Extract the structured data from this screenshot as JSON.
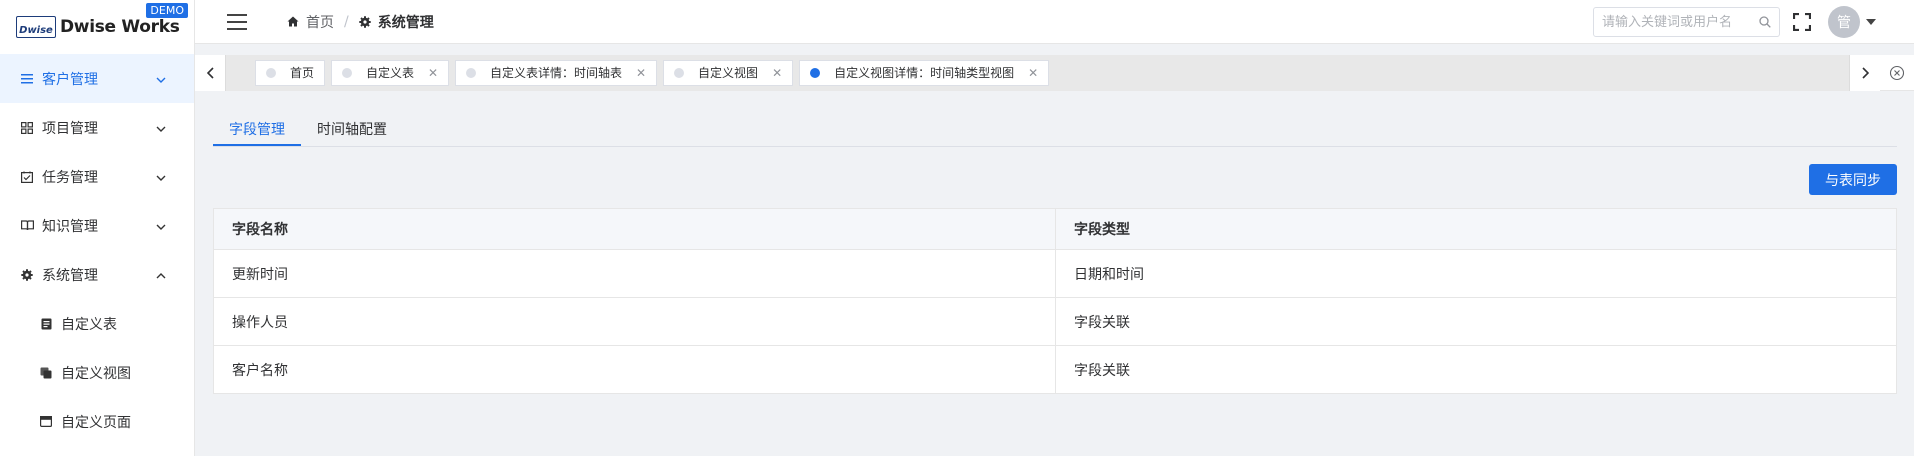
{
  "app": {
    "logo_mark": "Dwise",
    "title": "Dwise Works",
    "badge": "DEMO"
  },
  "sidebar": {
    "items": [
      {
        "label": "客户管理",
        "icon": "list-icon",
        "active": true,
        "expanded": false
      },
      {
        "label": "项目管理",
        "icon": "grid-icon",
        "active": false,
        "expanded": false
      },
      {
        "label": "任务管理",
        "icon": "check-square-icon",
        "active": false,
        "expanded": false
      },
      {
        "label": "知识管理",
        "icon": "book-icon",
        "active": false,
        "expanded": false
      },
      {
        "label": "系统管理",
        "icon": "gear-icon",
        "active": false,
        "expanded": true
      }
    ],
    "subitems": [
      {
        "label": "自定义表",
        "icon": "document-icon"
      },
      {
        "label": "自定义视图",
        "icon": "copy-icon"
      },
      {
        "label": "自定义页面",
        "icon": "window-icon"
      }
    ]
  },
  "header": {
    "breadcrumb": [
      {
        "label": "首页",
        "icon": "home-icon"
      },
      {
        "label": "系统管理",
        "icon": "gear-icon"
      }
    ],
    "search_placeholder": "请输入关键词或用户名",
    "avatar_text": "管"
  },
  "tags": [
    {
      "label": "首页",
      "closable": false,
      "active": false
    },
    {
      "label": "自定义表",
      "closable": true,
      "active": false
    },
    {
      "label": "自定义表详情：时间轴表",
      "closable": true,
      "active": false
    },
    {
      "label": "自定义视图",
      "closable": true,
      "active": false
    },
    {
      "label": "自定义视图详情：时间轴类型视图",
      "closable": true,
      "active": true
    }
  ],
  "main": {
    "tabs": [
      {
        "label": "字段管理",
        "active": true
      },
      {
        "label": "时间轴配置",
        "active": false
      }
    ],
    "sync_button": "与表同步",
    "table": {
      "headers": [
        "字段名称",
        "字段类型"
      ],
      "rows": [
        [
          "更新时间",
          "日期和时间"
        ],
        [
          "操作人员",
          "字段关联"
        ],
        [
          "客户名称",
          "字段关联"
        ]
      ]
    }
  },
  "colors": {
    "accent": "#1f6fe5",
    "active_bg": "#ecf4ff",
    "page_bg": "#f0f2f5"
  }
}
